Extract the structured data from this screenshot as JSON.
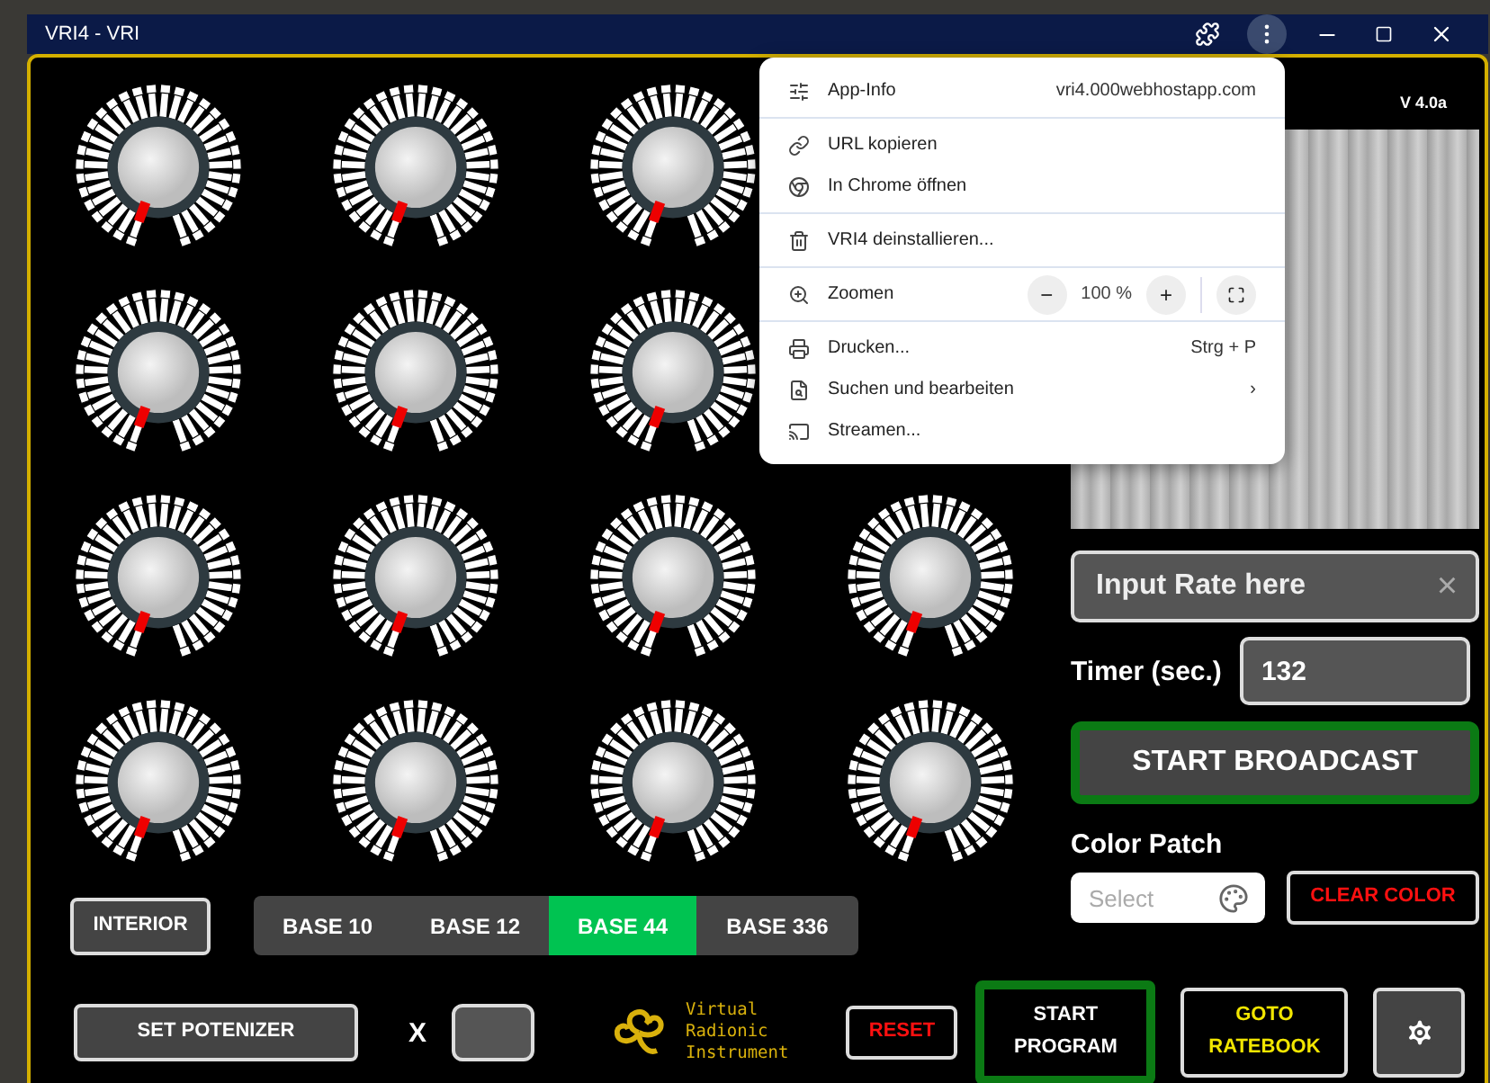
{
  "window": {
    "title": "VRI4 - VRI"
  },
  "version": "V 4.0a",
  "interior_button": "INTERIOR",
  "bases": [
    {
      "label": "BASE 10",
      "selected": false
    },
    {
      "label": "BASE 12",
      "selected": false
    },
    {
      "label": "BASE 44",
      "selected": true
    },
    {
      "label": "BASE 336",
      "selected": false
    }
  ],
  "rate_field": {
    "placeholder": "Input Rate here",
    "clear": "×"
  },
  "timer": {
    "label": "Timer (sec.)",
    "value": "132"
  },
  "broadcast_button": "START BROADCAST",
  "color_patch": {
    "label": "Color Patch",
    "placeholder": "Select",
    "clear_button": "CLEAR COLOR"
  },
  "bottom": {
    "potenizer_button": "SET POTENIZER",
    "multiplier": "X",
    "logo_lines": [
      "Virtual",
      "Radionic",
      "Instrument"
    ],
    "reset_button": "RESET",
    "start_program": [
      "START",
      "PROGRAM"
    ],
    "ratebook": [
      "GOTO",
      "RATEBOOK"
    ]
  },
  "menu": {
    "sections": [
      [
        {
          "kind": "item",
          "label": "App-Info",
          "detail": "vri4.000webhostapp.com"
        }
      ],
      [
        {
          "kind": "item",
          "label": "URL kopieren"
        },
        {
          "kind": "item",
          "label": "In Chrome öffnen"
        }
      ],
      [
        {
          "kind": "item",
          "label": "VRI4 deinstallieren..."
        }
      ],
      [
        {
          "kind": "zoom",
          "label": "Zoomen",
          "minus": "−",
          "value": "100 %",
          "plus": "+"
        }
      ],
      [
        {
          "kind": "item",
          "label": "Drucken...",
          "detail": "Strg + P"
        },
        {
          "kind": "item",
          "label": "Suchen und bearbeiten",
          "detail": "›"
        },
        {
          "kind": "item",
          "label": "Streamen..."
        }
      ]
    ]
  }
}
